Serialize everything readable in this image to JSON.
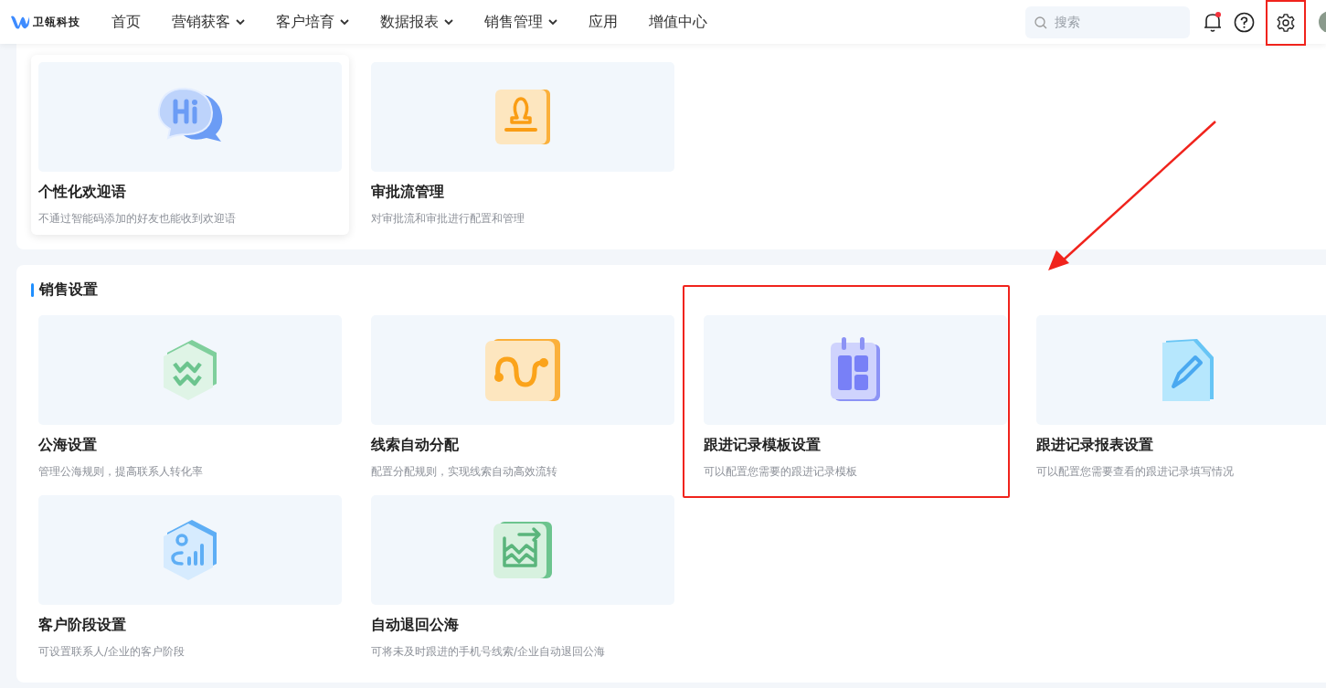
{
  "nav": {
    "logo": "卫瓴科技",
    "items": [
      {
        "label": "首页",
        "dropdown": false
      },
      {
        "label": "营销获客",
        "dropdown": true
      },
      {
        "label": "客户培育",
        "dropdown": true
      },
      {
        "label": "数据报表",
        "dropdown": true
      },
      {
        "label": "销售管理",
        "dropdown": true
      },
      {
        "label": "应用",
        "dropdown": false
      },
      {
        "label": "增值中心",
        "dropdown": false
      }
    ],
    "search": {
      "placeholder": "搜索"
    },
    "notification_dot": true,
    "settings_highlighted": true
  },
  "sections": [
    {
      "cards": [
        {
          "kind": "hi",
          "title": "个性化欢迎语",
          "description": "不通过智能码添加的好友也能收到欢迎语",
          "hovered": true,
          "highlighted": false
        },
        {
          "kind": "stamp",
          "title": "审批流管理",
          "description": "对审批流和审批进行配置和管理",
          "hovered": false,
          "highlighted": false
        }
      ]
    },
    {
      "title": "销售设置",
      "cards": [
        {
          "kind": "sea",
          "title": "公海设置",
          "description": "管理公海规则，提高联系人转化率",
          "hovered": false,
          "highlighted": false
        },
        {
          "kind": "route",
          "title": "线索自动分配",
          "description": "配置分配规则，实现线索自动高效流转",
          "hovered": false,
          "highlighted": false
        },
        {
          "kind": "calendar",
          "title": "跟进记录模板设置",
          "description": "可以配置您需要的跟进记录模板",
          "hovered": false,
          "highlighted": true
        },
        {
          "kind": "doc",
          "title": "跟进记录报表设置",
          "description": "可以配置您需要查看的跟进记录填写情况",
          "hovered": false,
          "highlighted": false
        },
        {
          "kind": "stage",
          "title": "客户阶段设置",
          "description": "可设置联系人/企业的客户阶段",
          "hovered": false,
          "highlighted": false
        },
        {
          "kind": "return",
          "title": "自动退回公海",
          "description": "可将未及时跟进的手机号线索/企业自动退回公海",
          "hovered": false,
          "highlighted": false
        }
      ]
    }
  ]
}
